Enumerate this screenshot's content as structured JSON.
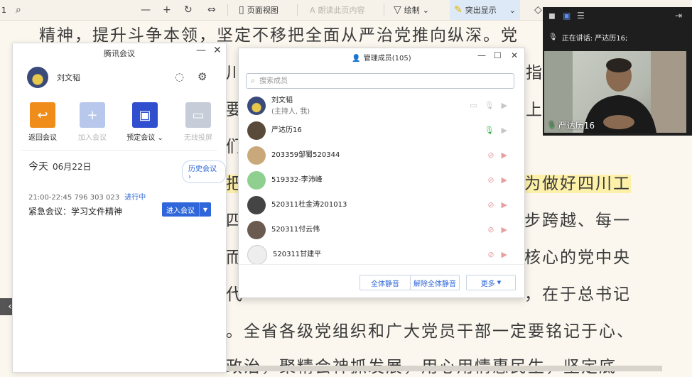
{
  "toolbar": {
    "page_num": "1",
    "zoom_out": "—",
    "zoom_in": "+",
    "page_view": "页面视图",
    "read_aloud": "朗读此页内容",
    "draw": "绘制",
    "highlight": "突出显示"
  },
  "document": {
    "lines": [
      "精神，提升斗争本领，坚定不移把全面从严治党推向纵深。党",
      "川",
      "要",
      "们",
      "把",
      "四",
      "而",
      "代",
      "。全省各级党组织和广大党员干部一定要铭记于心、",
      "政治，聚精会神抓发展，用心用情惠民生，坚定底"
    ],
    "right_fragments": [
      "指",
      "上",
      "为做好四川工",
      "步跨越、每一",
      "核心的党中央",
      "，在于总书记"
    ]
  },
  "meeting": {
    "title": "腾讯会议",
    "user_name": "刘文韬",
    "actions": [
      {
        "label": "返回会议",
        "icon": "return-icon",
        "color": "#f08c1a"
      },
      {
        "label": "加入会议",
        "icon": "plus-icon",
        "color": "#b8c8ec"
      },
      {
        "label": "预定会议",
        "icon": "calendar-icon",
        "color": "#2f4fcf"
      },
      {
        "label": "无线投屏",
        "icon": "screen-cast-icon",
        "color": "#c6ccd8"
      }
    ],
    "today_label": "今天",
    "today_date": "06月22日",
    "history_button": "历史会议",
    "meeting_time": "21:00-22:45",
    "meeting_id": "796 303 023",
    "meeting_status": "进行中",
    "meeting_name": "紧急会议：学习文件精神",
    "join_button": "进入会议"
  },
  "members_panel": {
    "title": "管理成员(105)",
    "search_placeholder": "搜索成员",
    "members": [
      {
        "name": "刘文韬",
        "sub": "(主持人, 我)",
        "mic": "dim",
        "video": "dim",
        "avatar_color": "#3a4a7a"
      },
      {
        "name": "严达历16",
        "sub": "",
        "mic": "on",
        "video": "dim",
        "avatar_color": "#5a4a3a"
      },
      {
        "name": "203359邹蜀520344",
        "sub": "",
        "mic": "muted",
        "video": "muted",
        "avatar_color": "#c9a97a"
      },
      {
        "name": "519332-李沛峰",
        "sub": "",
        "mic": "muted",
        "video": "muted",
        "avatar_color": "#8fcf8f"
      },
      {
        "name": "520311杜金涛201013",
        "sub": "",
        "mic": "muted",
        "video": "muted",
        "avatar_color": "#444444"
      },
      {
        "name": "520311付云伟",
        "sub": "",
        "mic": "muted",
        "video": "muted",
        "avatar_color": "#6a5a50"
      },
      {
        "name": "520311甘建平",
        "sub": "",
        "mic": "muted",
        "video": "muted",
        "avatar_color": "#eeeeee"
      }
    ],
    "mute_all": "全体静音",
    "unmute_all": "解除全体静音",
    "more": "更多"
  },
  "video": {
    "speaking_text": "正在讲话: 严达历16;",
    "speaker_label": "严达历16"
  }
}
